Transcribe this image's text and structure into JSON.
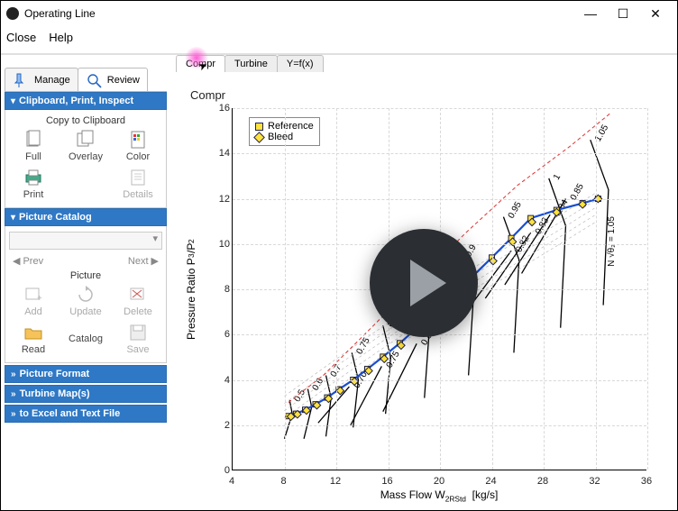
{
  "window": {
    "title": "Operating Line",
    "menu": {
      "close": "Close",
      "help": "Help"
    }
  },
  "sidebar": {
    "tabs": {
      "manage": "Manage",
      "review": "Review"
    },
    "panels": {
      "clip": {
        "title": "Clipboard, Print, Inspect",
        "sub": "Copy to Clipboard",
        "full": "Full",
        "overlay": "Overlay",
        "color": "Color",
        "print": "Print",
        "details": "Details"
      },
      "cat": {
        "title": "Picture Catalog",
        "prev": "Prev",
        "next": "Next",
        "pic": "Picture",
        "add": "Add",
        "update": "Update",
        "delete": "Delete",
        "read": "Read",
        "catalog": "Catalog",
        "save": "Save"
      },
      "fmt": "Picture Format",
      "turb": "Turbine Map(s)",
      "excel": "to Excel and Text File"
    }
  },
  "tabs": {
    "compr": "Compr",
    "turbine": "Turbine",
    "yfx": "Y=f(x)"
  },
  "chart_data": {
    "type": "line",
    "title": "Compr",
    "xlabel": "Mass Flow W_2RStd  [kg/s]",
    "ylabel": "Pressure Ratio P_3/P_2",
    "xlim": [
      4,
      36
    ],
    "ylim": [
      0,
      16
    ],
    "xticks": [
      4,
      8,
      12,
      16,
      20,
      24,
      28,
      32,
      36
    ],
    "yticks": [
      0,
      2,
      4,
      6,
      8,
      10,
      12,
      14,
      16
    ],
    "legend": [
      "Reference",
      "Bleed"
    ],
    "series": [
      {
        "name": "Reference",
        "values": [
          [
            8.3,
            2.4
          ],
          [
            8.9,
            2.5
          ],
          [
            9.6,
            2.68
          ],
          [
            10.4,
            2.92
          ],
          [
            11.3,
            3.22
          ],
          [
            12.2,
            3.58
          ],
          [
            13.3,
            4.0
          ],
          [
            14.4,
            4.48
          ],
          [
            15.6,
            5.02
          ],
          [
            16.9,
            5.62
          ],
          [
            18.2,
            6.28
          ],
          [
            19.6,
            7.0
          ],
          [
            21.0,
            7.76
          ],
          [
            22.5,
            8.56
          ],
          [
            24.0,
            9.4
          ],
          [
            25.5,
            10.26
          ],
          [
            27.0,
            11.14
          ],
          [
            29.0,
            11.5
          ],
          [
            31.0,
            11.8
          ],
          [
            32.2,
            12.0
          ]
        ]
      },
      {
        "name": "Bleed",
        "values": [
          [
            8.5,
            2.38
          ],
          [
            9.0,
            2.48
          ],
          [
            9.7,
            2.65
          ],
          [
            10.5,
            2.88
          ],
          [
            11.4,
            3.17
          ],
          [
            12.3,
            3.52
          ],
          [
            13.4,
            3.93
          ],
          [
            14.5,
            4.4
          ],
          [
            15.7,
            4.93
          ],
          [
            17.0,
            5.52
          ],
          [
            18.3,
            6.17
          ],
          [
            19.7,
            6.88
          ],
          [
            21.1,
            7.63
          ],
          [
            22.6,
            8.42
          ],
          [
            24.1,
            9.25
          ],
          [
            25.6,
            10.1
          ],
          [
            27.1,
            10.97
          ],
          [
            29.0,
            11.4
          ],
          [
            31.0,
            11.75
          ],
          [
            32.2,
            12.0
          ]
        ]
      }
    ],
    "speed_labels": [
      "0.5",
      "0.6",
      "0.7",
      "0.70",
      "0.75",
      "0.75",
      "0.8",
      "0.80",
      "0.82",
      "0.83",
      "0.84",
      "0.85",
      "0.85",
      "0.9",
      "0.95",
      "1"
    ],
    "speed_marker": "N √θ₂ = 1.05",
    "speed_lines": [
      {
        "label": "0.5",
        "pts": [
          [
            8.0,
            1.4
          ],
          [
            8.6,
            2.5
          ],
          [
            8.4,
            3.1
          ]
        ]
      },
      {
        "label": "0.6",
        "pts": [
          [
            9.5,
            1.4
          ],
          [
            10.1,
            2.8
          ],
          [
            9.8,
            3.6
          ]
        ]
      },
      {
        "label": "0.70",
        "pts": [
          [
            10.6,
            2.1
          ],
          [
            13.0,
            3.7
          ]
        ]
      },
      {
        "label": "0.7",
        "pts": [
          [
            11.2,
            1.5
          ],
          [
            11.6,
            3.2
          ],
          [
            11.2,
            4.2
          ]
        ]
      },
      {
        "label": "0.75",
        "pts": [
          [
            13.1,
            2.0
          ],
          [
            15.5,
            4.6
          ]
        ]
      },
      {
        "label": "0.75",
        "pts": [
          [
            13.3,
            1.9
          ],
          [
            13.7,
            4.0
          ],
          [
            13.2,
            5.2
          ]
        ]
      },
      {
        "label": "0.8",
        "pts": [
          [
            15.8,
            2.5
          ],
          [
            16.2,
            5.0
          ],
          [
            15.6,
            6.4
          ]
        ]
      },
      {
        "label": "0.80",
        "pts": [
          [
            15.6,
            2.6
          ],
          [
            18.2,
            5.6
          ]
        ]
      },
      {
        "label": "0.82",
        "pts": [
          [
            22.0,
            7.0
          ],
          [
            25.5,
            9.7
          ]
        ]
      },
      {
        "label": "0.83",
        "pts": [
          [
            23.5,
            7.6
          ],
          [
            27.0,
            10.5
          ]
        ]
      },
      {
        "label": "0.84",
        "pts": [
          [
            25.0,
            8.2
          ],
          [
            28.5,
            11.3
          ]
        ]
      },
      {
        "label": "0.85",
        "pts": [
          [
            18.8,
            3.2
          ],
          [
            19.2,
            6.4
          ],
          [
            18.4,
            7.9
          ]
        ]
      },
      {
        "label": "0.85",
        "pts": [
          [
            26.3,
            8.7
          ],
          [
            29.7,
            12.0
          ]
        ]
      },
      {
        "label": "0.9",
        "pts": [
          [
            22.2,
            4.2
          ],
          [
            22.6,
            7.8
          ],
          [
            21.6,
            9.5
          ]
        ]
      },
      {
        "label": "0.95",
        "pts": [
          [
            25.7,
            5.2
          ],
          [
            26.1,
            9.3
          ],
          [
            24.9,
            11.2
          ]
        ]
      },
      {
        "label": "1",
        "pts": [
          [
            29.3,
            6.3
          ],
          [
            29.7,
            10.8
          ],
          [
            28.4,
            12.9
          ]
        ]
      },
      {
        "label": "1.05",
        "pts": [
          [
            32.6,
            7.3
          ],
          [
            33.0,
            12.4
          ],
          [
            31.6,
            14.6
          ]
        ]
      }
    ],
    "surge_line": [
      [
        8.3,
        3.0
      ],
      [
        11.0,
        4.2
      ],
      [
        14.0,
        5.9
      ],
      [
        18.0,
        8.2
      ],
      [
        22.0,
        10.5
      ],
      [
        26.0,
        12.6
      ],
      [
        30.0,
        14.3
      ],
      [
        33.2,
        15.8
      ]
    ]
  }
}
